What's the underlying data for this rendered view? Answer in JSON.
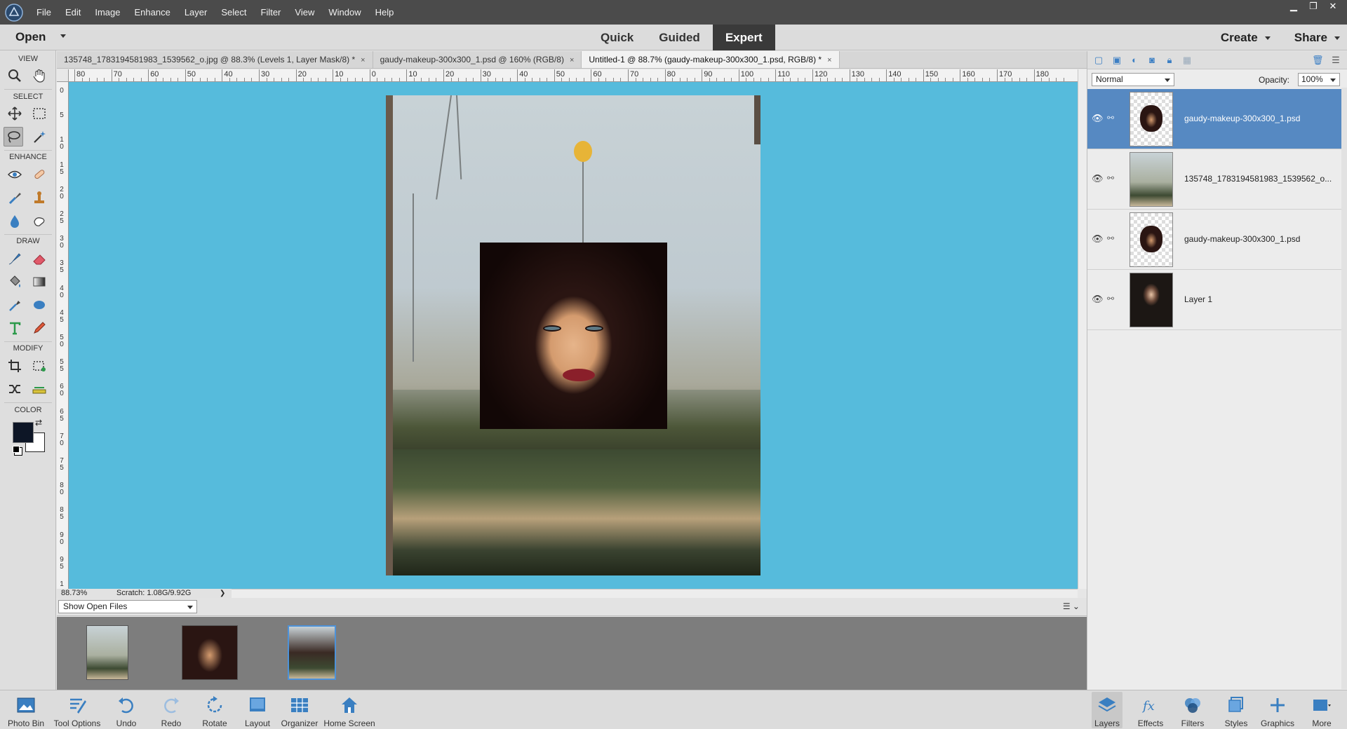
{
  "menubar": {
    "items": [
      "File",
      "Edit",
      "Image",
      "Enhance",
      "Layer",
      "Select",
      "Filter",
      "View",
      "Window",
      "Help"
    ]
  },
  "modebar": {
    "open_label": "Open",
    "modes": [
      "Quick",
      "Guided",
      "Expert"
    ],
    "active_mode": "Expert",
    "right": [
      "Create",
      "Share"
    ]
  },
  "toolbox": {
    "sections": [
      "VIEW",
      "SELECT",
      "ENHANCE",
      "DRAW",
      "MODIFY",
      "COLOR"
    ]
  },
  "tabs": [
    {
      "label": "135748_1783194581983_1539562_o.jpg @ 88.3% (Levels 1, Layer Mask/8) *",
      "close": "×"
    },
    {
      "label": "gaudy-makeup-300x300_1.psd @ 160% (RGB/8)",
      "close": "×"
    },
    {
      "label": "Untitled-1 @ 88.7% (gaudy-makeup-300x300_1.psd, RGB/8) *",
      "close": "×"
    }
  ],
  "ruler_top": [
    "80",
    "70",
    "60",
    "50",
    "40",
    "30",
    "20",
    "10",
    "0",
    "10",
    "20",
    "30",
    "40",
    "50",
    "60",
    "70",
    "80",
    "90",
    "100",
    "110",
    "120",
    "130",
    "140",
    "150",
    "160",
    "170",
    "180"
  ],
  "ruler_left": [
    "0",
    "5",
    "1 0",
    "1 5",
    "2 0",
    "2 5",
    "3 0",
    "3 5",
    "4 0",
    "4 5",
    "5 0",
    "5 5",
    "6 0",
    "6 5",
    "7 0",
    "7 5",
    "8 0",
    "8 5",
    "9 0",
    "9 5",
    "1"
  ],
  "status": {
    "zoom": "88.73%",
    "scratch": "Scratch: 1.08G/9.92G"
  },
  "bin": {
    "select": "Show Open Files"
  },
  "layers_panel": {
    "blend_mode": "Normal",
    "opacity_label": "Opacity:",
    "opacity_value": "100%",
    "layers": [
      {
        "name": "gaudy-makeup-300x300_1.psd",
        "selected": true
      },
      {
        "name": "135748_1783194581983_1539562_o...",
        "selected": false
      },
      {
        "name": "gaudy-makeup-300x300_1.psd",
        "selected": false
      },
      {
        "name": "Layer 1",
        "selected": false
      }
    ]
  },
  "bottombar": {
    "left": [
      "Photo Bin",
      "Tool Options",
      "Undo",
      "Redo",
      "Rotate",
      "Layout",
      "Organizer",
      "Home Screen"
    ],
    "right": [
      "Layers",
      "Effects",
      "Filters",
      "Styles",
      "Graphics",
      "More"
    ]
  },
  "colors": {
    "canvas_bg": "#56bbdc",
    "foreground": "#0d1626",
    "background": "#ffffff",
    "selection": "#5689c2"
  }
}
